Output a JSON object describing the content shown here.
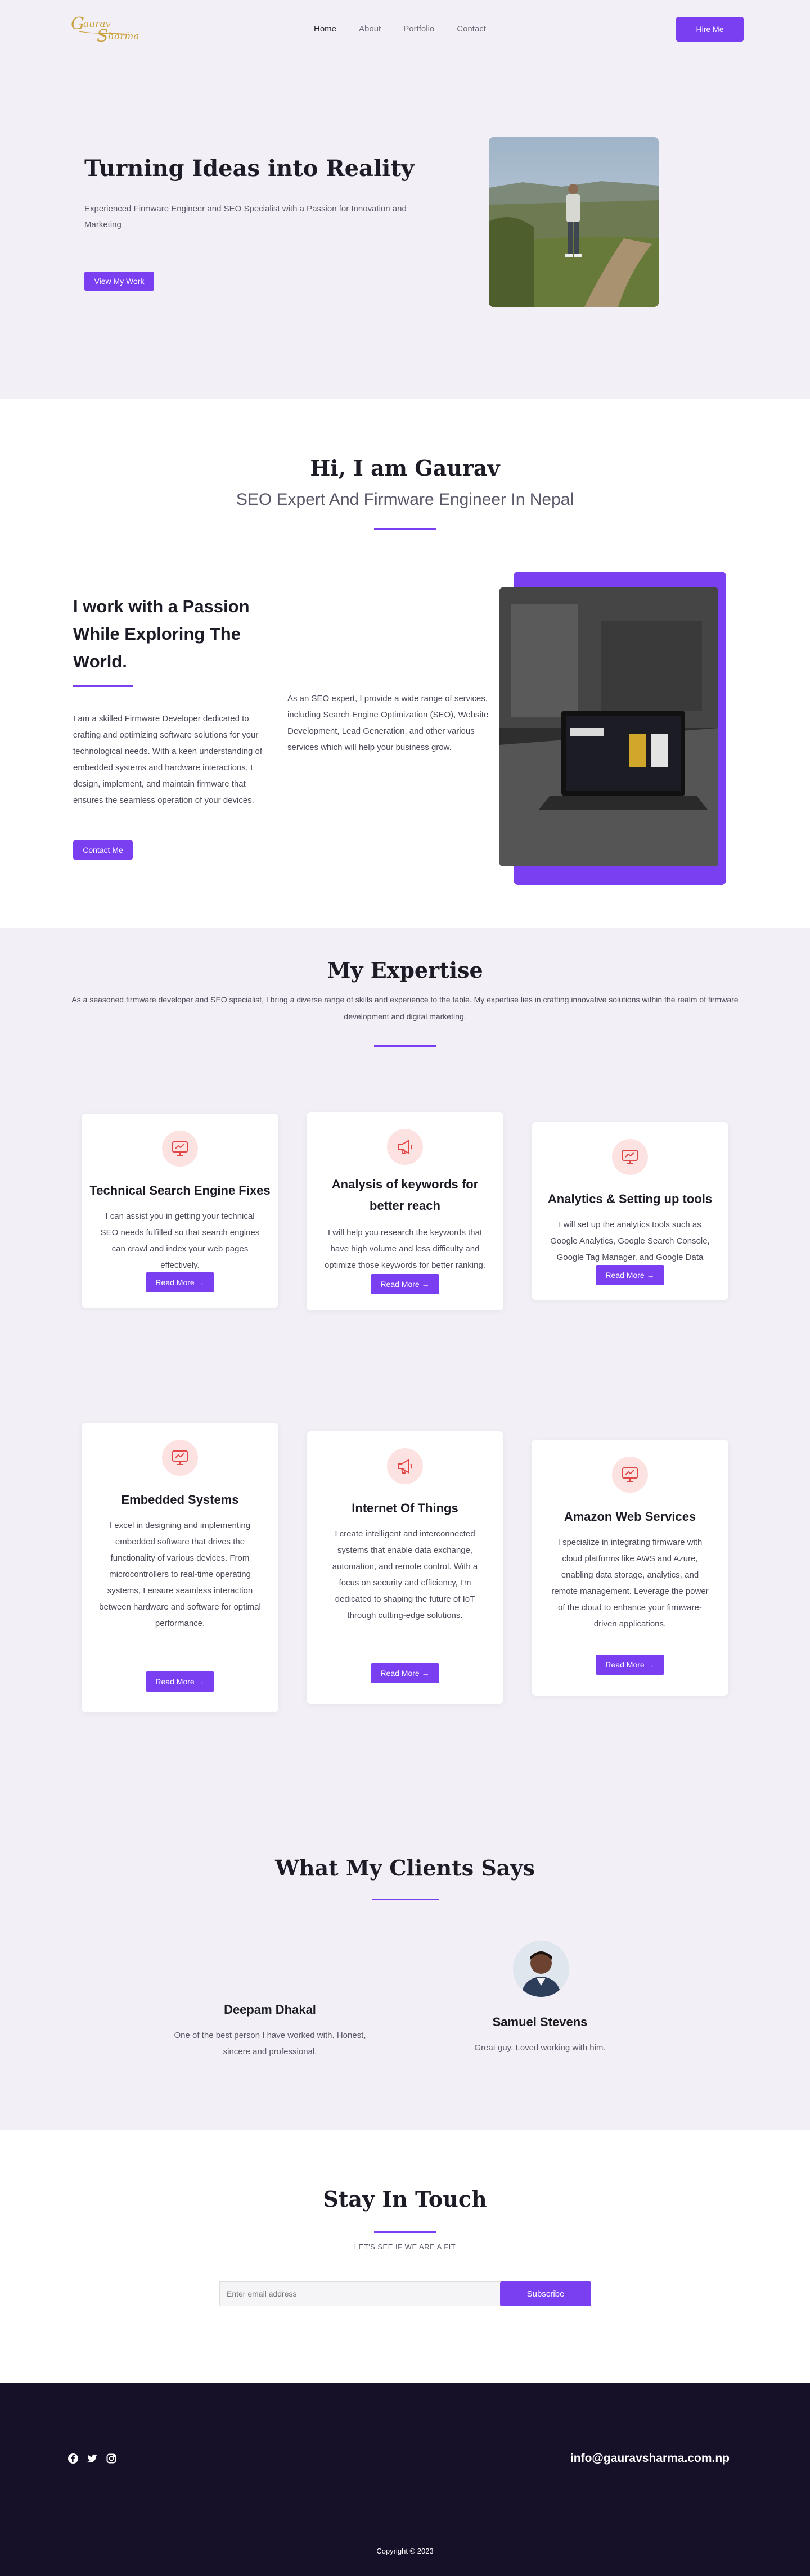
{
  "header": {
    "logo_text": "Gaurav Sharma",
    "nav": [
      {
        "label": "Home",
        "active": true
      },
      {
        "label": "About",
        "active": false
      },
      {
        "label": "Portfolio",
        "active": false
      },
      {
        "label": "Contact",
        "active": false
      }
    ],
    "hire_label": "Hire Me"
  },
  "hero": {
    "title": "Turning Ideas into Reality",
    "subtitle": "Experienced Firmware Engineer and SEO Specialist with a Passion for Innovation and Marketing",
    "cta_label": "View My Work"
  },
  "about": {
    "heading": "Hi, I am Gaurav",
    "subheading": "SEO Expert And Firmware Engineer In Nepal",
    "lead": "I work with a Passion While Exploring The World.",
    "para1": "I am a skilled Firmware Developer dedicated to crafting and optimizing software solutions for your technological needs. With a keen understanding of embedded systems and hardware interactions, I design, implement, and maintain firmware that ensures the seamless operation of your devices.",
    "para2": "As an SEO expert, I provide a wide range of services, including Search Engine Optimization (SEO), Website Development, Lead Generation, and other various services which will help your business grow.",
    "cta_label": "Contact Me"
  },
  "expertise": {
    "heading": "My Expertise",
    "intro": "As a seasoned firmware developer and SEO specialist, I bring a diverse range of skills and experience to the table. My expertise lies in crafting innovative solutions within the realm of firmware development and digital marketing.",
    "read_more": "Read More",
    "cards": [
      {
        "icon": "monitor-icon",
        "title": "Technical Search Engine Fixes",
        "desc": "I can assist you in getting your technical SEO needs fulfilled so that search engines can crawl and index your web pages effectively."
      },
      {
        "icon": "megaphone-icon",
        "title": "Analysis of keywords for better reach",
        "desc": "I will help you research the keywords that have high volume and less difficulty and optimize those keywords for better ranking."
      },
      {
        "icon": "monitor-icon",
        "title": "Analytics & Setting up tools",
        "desc": "I will set up the analytics tools such as Google Analytics, Google Search Console, Google Tag Manager, and Google Data Studio."
      },
      {
        "icon": "monitor-icon",
        "title": "Embedded Systems",
        "desc": "I excel in designing and implementing embedded software that drives the functionality of various devices. From microcontrollers to real-time operating systems, I ensure seamless interaction between hardware and software for optimal performance."
      },
      {
        "icon": "megaphone-icon",
        "title": "Internet Of Things",
        "desc": "I create intelligent and interconnected systems that enable data exchange, automation, and remote control. With a focus on security and efficiency, I'm dedicated to shaping the future of IoT through cutting-edge solutions."
      },
      {
        "icon": "monitor-icon",
        "title": "Amazon Web Services",
        "desc": "I specialize in integrating firmware with cloud platforms like AWS and Azure, enabling data storage, analytics, and remote management. Leverage the power of the cloud to enhance your firmware-driven applications."
      }
    ]
  },
  "testimonials": {
    "heading": "What My Clients Says",
    "items": [
      {
        "name": "Deepam Dhakal",
        "quote": "One of the best person I have worked with. Honest, sincere and professional."
      },
      {
        "name": "Samuel Stevens",
        "quote": "Great guy. Loved working with him."
      }
    ]
  },
  "contact": {
    "heading": "Stay In Touch",
    "tagline": "LET'S SEE IF WE ARE A FIT",
    "email_placeholder": "Enter email address",
    "subscribe_label": "Subscribe"
  },
  "footer": {
    "email": "info@gauravsharma.com.np",
    "copyright": "Copyright © 2023",
    "social": [
      "facebook-icon",
      "twitter-icon",
      "instagram-icon"
    ]
  },
  "colors": {
    "accent": "#7b3ff2",
    "background": "#f2f0f6",
    "footer": "#161029",
    "icon_bg": "#fde2e2",
    "icon_stroke": "#e04848"
  }
}
